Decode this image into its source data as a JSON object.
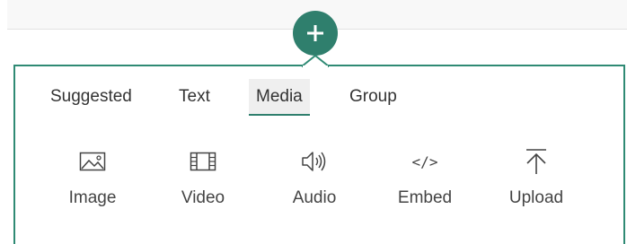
{
  "toolbox": {
    "add_button_icon": "plus-icon",
    "accent_color": "#2f7f6d",
    "tabs": [
      {
        "label": "Suggested",
        "active": false
      },
      {
        "label": "Text",
        "active": false
      },
      {
        "label": "Media",
        "active": true
      },
      {
        "label": "Group",
        "active": false
      }
    ],
    "tools": [
      {
        "label": "Image",
        "icon": "image-icon"
      },
      {
        "label": "Video",
        "icon": "video-icon"
      },
      {
        "label": "Audio",
        "icon": "audio-icon"
      },
      {
        "label": "Embed",
        "icon": "embed-icon",
        "glyph": "</>"
      },
      {
        "label": "Upload",
        "icon": "upload-icon"
      }
    ]
  }
}
